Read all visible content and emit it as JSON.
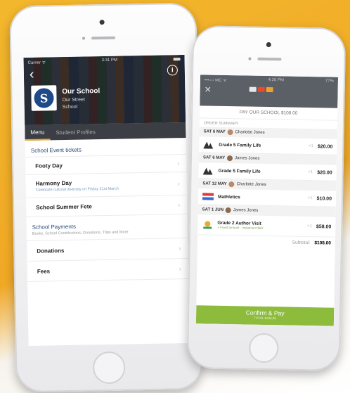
{
  "left_phone": {
    "status": {
      "carrier": "Carrier ᯤ",
      "time": "3:31 PM"
    },
    "school": {
      "name": "Our School",
      "street": "Our Street",
      "type": "School",
      "logo_letter": "S"
    },
    "tabs": [
      {
        "label": "Menu",
        "active": true
      },
      {
        "label": "Student Profiles",
        "active": false
      }
    ],
    "event_section": {
      "title": "School Event tickets",
      "items": [
        {
          "title": "Footy Day",
          "subtitle": ""
        },
        {
          "title": "Harmony Day",
          "subtitle": "Celebrate cultural diversity on Friday 21st March"
        },
        {
          "title": "School Summer Fete",
          "subtitle": ""
        }
      ]
    },
    "payments_section": {
      "title": "School Payments",
      "subtitle": "Books, School Contributions, Donations, Trips and More",
      "items": [
        {
          "title": "Donations"
        },
        {
          "title": "Fees"
        }
      ]
    },
    "chevron_icon": "›"
  },
  "right_phone": {
    "status": {
      "carrier": "•••○○ MC ᯤ",
      "time": "4:20 PM",
      "battery": "77%"
    },
    "close_icon": "✕",
    "title": "PAY OUR SCHOOL $108.00",
    "summary_label": "ORDER SUMMARY",
    "groups": [
      {
        "date": "SAT 6 MAY",
        "person": "Charlotte Jones",
        "item": {
          "title": "Grade 5 Family Life",
          "qty": "×1",
          "price": "$20.00",
          "note": ""
        }
      },
      {
        "date": "SAT 6 MAY",
        "person": "James Jones",
        "item": {
          "title": "Grade 5 Family Life",
          "qty": "×1",
          "price": "$20.00",
          "note": ""
        }
      },
      {
        "date": "SAT 12 MAY",
        "person": "Charlotte Jones",
        "item": {
          "title": "Mathletics",
          "qty": "×1",
          "price": "$10.00",
          "note": ""
        }
      },
      {
        "date": "SAT 1 JUN",
        "person": "James Jones",
        "item": {
          "title": "Grade 2 Author Visit",
          "qty": "×1",
          "price": "$58.00",
          "note": "+ Fixed amount · Instalment $50"
        }
      }
    ],
    "subtotal_label": "Subtotal:",
    "subtotal_value": "$108.00",
    "confirm_label": "Confirm & Pay",
    "confirm_sub": "TOTAL $108.00"
  }
}
